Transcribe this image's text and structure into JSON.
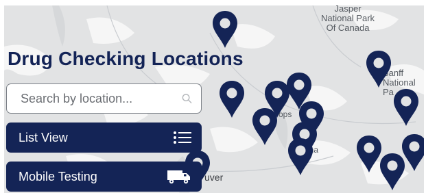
{
  "header": {
    "title": "Drug Checking Locations"
  },
  "search": {
    "placeholder": "Search by location...",
    "value": ""
  },
  "buttons": {
    "list_view": "List View",
    "mobile_testing": "Mobile Testing"
  },
  "map": {
    "labels": {
      "jasper": "Jasper\nNational Park\nOf Canada",
      "banff": "Banff\nNational Pa",
      "vancouver": "uver",
      "hope": "ops",
      "kelowna": "elowna"
    },
    "pin_count": 14,
    "pin_color": "#142456"
  },
  "colors": {
    "primary": "#142456",
    "title": "#132356",
    "map_bg": "#e2e3e4"
  },
  "icons": {
    "search": "search-icon",
    "list": "list-icon",
    "truck": "truck-icon",
    "pin": "map-pin-icon"
  }
}
